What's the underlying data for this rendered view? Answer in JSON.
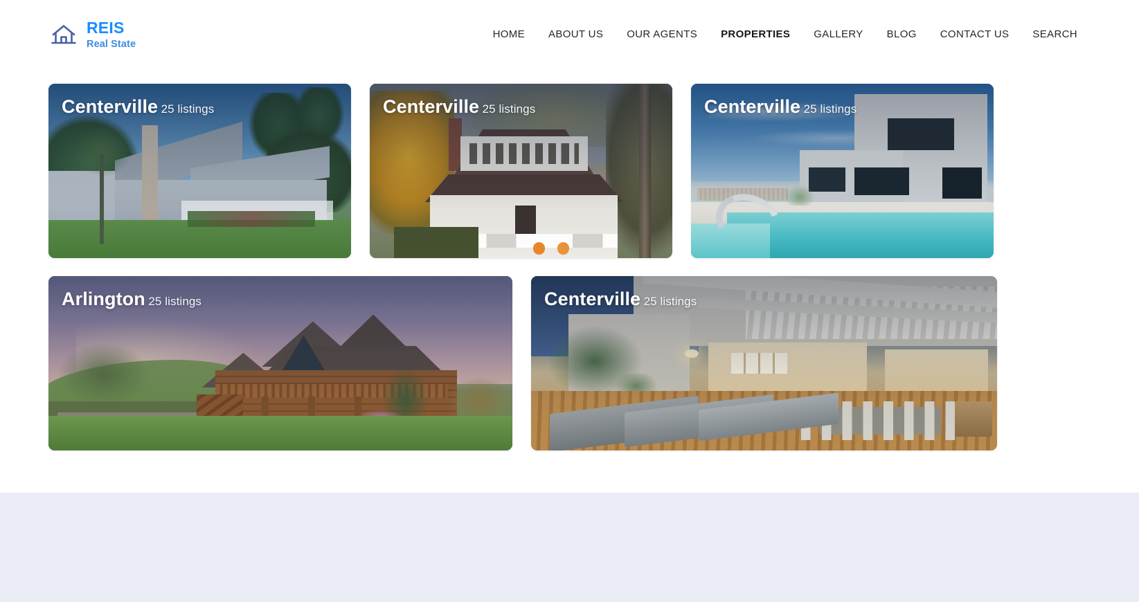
{
  "header": {
    "brand": {
      "icon": "house-icon",
      "title": "REIS",
      "subtitle": "Real State",
      "title_color": "#1a8cff",
      "subtitle_color": "#3d8ce0",
      "icon_color": "#4a5fa5"
    },
    "nav": [
      {
        "label": "HOME",
        "active": false
      },
      {
        "label": "ABOUT US",
        "active": false
      },
      {
        "label": "OUR AGENTS",
        "active": false
      },
      {
        "label": "PROPERTIES",
        "active": true
      },
      {
        "label": "GALLERY",
        "active": false
      },
      {
        "label": "BLOG",
        "active": false
      },
      {
        "label": "CONTACT US",
        "active": false
      },
      {
        "label": "SEARCH",
        "active": false
      }
    ]
  },
  "main": {
    "rows": [
      {
        "cards": [
          {
            "title": "Centerville",
            "listings": "25 listings"
          },
          {
            "title": "Centerville",
            "listings": "25 listings"
          },
          {
            "title": "Centerville",
            "listings": "25 listings"
          }
        ]
      },
      {
        "cards": [
          {
            "title": "Arlington",
            "listings": "25 listings"
          },
          {
            "title": "Centerville",
            "listings": "25 listings"
          }
        ]
      }
    ]
  },
  "footer": {
    "background_color": "#eaedf5"
  }
}
